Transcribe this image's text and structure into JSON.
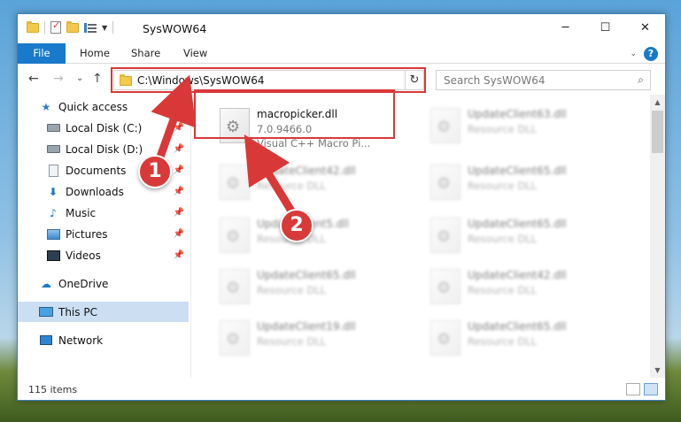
{
  "window": {
    "title": "SysWOW64",
    "minimize": "─",
    "maximize": "☐",
    "close": "✕"
  },
  "ribbon": {
    "tabs": [
      {
        "label": "File"
      },
      {
        "label": "Home"
      },
      {
        "label": "Share"
      },
      {
        "label": "View"
      }
    ],
    "expand_chevron": "⌄",
    "help": "?"
  },
  "nav": {
    "back": "←",
    "forward": "→",
    "recent": "⌄",
    "up": "↑"
  },
  "address": {
    "path": "C:\\Windows\\SysWOW64",
    "dropdown": "⌄",
    "refresh": "↻"
  },
  "search": {
    "placeholder": "Search SysWOW64",
    "icon": "⌕"
  },
  "sidebar": {
    "items": [
      {
        "label": "Quick access",
        "icon": "star-icon"
      },
      {
        "label": "Local Disk (C:)",
        "icon": "disk-icon",
        "pinned": true
      },
      {
        "label": "Local Disk (D:)",
        "icon": "disk-icon",
        "pinned": true
      },
      {
        "label": "Documents",
        "icon": "documents-icon",
        "pinned": true
      },
      {
        "label": "Downloads",
        "icon": "download-icon",
        "pinned": true
      },
      {
        "label": "Music",
        "icon": "music-icon",
        "pinned": true
      },
      {
        "label": "Pictures",
        "icon": "pictures-icon",
        "pinned": true
      },
      {
        "label": "Videos",
        "icon": "videos-icon",
        "pinned": true
      },
      {
        "label": "OneDrive",
        "icon": "cloud-icon"
      },
      {
        "label": "This PC",
        "icon": "computer-icon",
        "selected": true
      },
      {
        "label": "Network",
        "icon": "network-icon"
      }
    ]
  },
  "files": [
    {
      "name": "macropicker.dll",
      "line2": "7.0.9466.0",
      "line3": "Visual C++ Macro Pi...",
      "highlighted": true
    },
    {
      "name": "UpdateClient63.dll",
      "line2": "Resource DLL"
    },
    {
      "name": "UpdateClient42.dll",
      "line2": "Resource DLL"
    },
    {
      "name": "UpdateClient65.dll",
      "line2": "Resource DLL"
    },
    {
      "name": "UpdateClient5.dll",
      "line2": "Resource DLL"
    },
    {
      "name": "UpdateClient65.dll",
      "line2": "Resource DLL"
    },
    {
      "name": "UpdateClient65.dll",
      "line2": "Resource DLL"
    },
    {
      "name": "UpdateClient42.dll",
      "line2": "Resource DLL"
    },
    {
      "name": "UpdateClient19.dll",
      "line2": "Resource DLL"
    },
    {
      "name": "UpdateClient65.dll",
      "line2": "Resource DLL"
    }
  ],
  "status": {
    "item_count": "115 items"
  },
  "annotations": {
    "badge1": "1",
    "badge2": "2",
    "color": "#d93838"
  },
  "scroll": {
    "up": "▲",
    "down": "▼"
  }
}
